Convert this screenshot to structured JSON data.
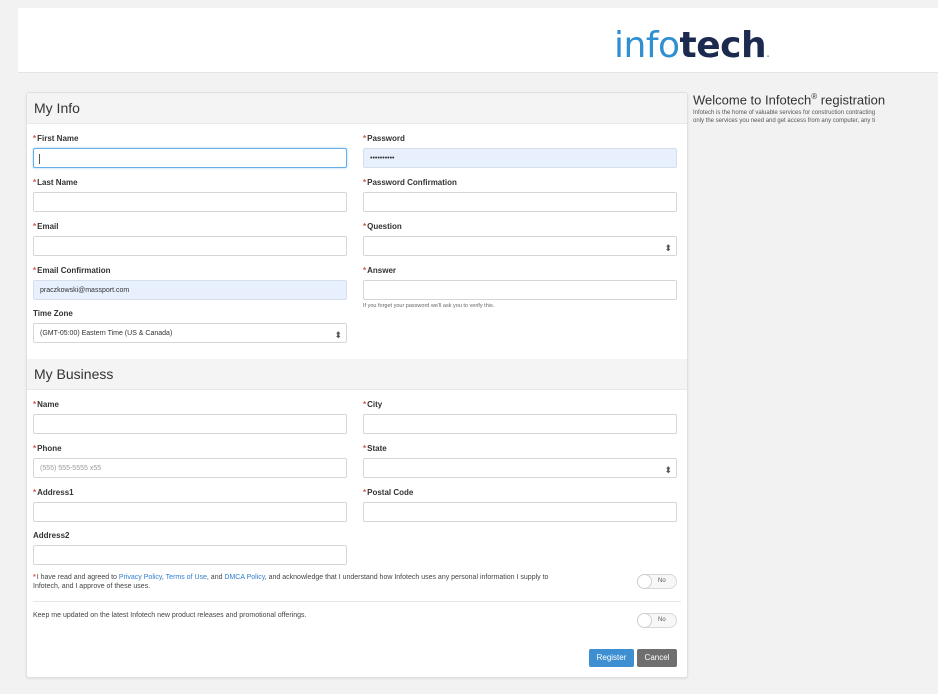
{
  "header": {
    "logo_part1": "info",
    "logo_part2": "tech",
    "logo_dot": "."
  },
  "my_info": {
    "heading": "My Info",
    "first_name": {
      "label": "First Name",
      "value": ""
    },
    "last_name": {
      "label": "Last Name",
      "value": ""
    },
    "email": {
      "label": "Email",
      "value": ""
    },
    "email_confirmation": {
      "label": "Email Confirmation",
      "value": "praczkowski@massport.com"
    },
    "time_zone": {
      "label": "Time Zone",
      "value": "(GMT-05:00) Eastern Time (US & Canada)"
    },
    "password": {
      "label": "Password",
      "value": "••••••••••"
    },
    "password_confirmation": {
      "label": "Password Confirmation",
      "value": ""
    },
    "question": {
      "label": "Question",
      "value": ""
    },
    "answer": {
      "label": "Answer",
      "value": "",
      "hint": "If you forget your password we'll ask you to verify this."
    }
  },
  "my_business": {
    "heading": "My Business",
    "name": {
      "label": "Name",
      "value": ""
    },
    "phone": {
      "label": "Phone",
      "placeholder": "(555) 555-5555 x55"
    },
    "address1": {
      "label": "Address1",
      "value": ""
    },
    "address2": {
      "label": "Address2",
      "value": ""
    },
    "city": {
      "label": "City",
      "value": ""
    },
    "state": {
      "label": "State",
      "value": ""
    },
    "postal_code": {
      "label": "Postal Code",
      "value": ""
    }
  },
  "consent": {
    "text_before": "I have read and agreed to ",
    "privacy_link": "Privacy Policy",
    "sep1": ", ",
    "terms_link": "Terms of Use",
    "sep2": ", and ",
    "dmca_link": "DMCA Policy",
    "text_after": ", and acknowledge that I understand how Infotech uses any personal information I supply to Infotech, and I approve of these uses.",
    "toggle_label": "No"
  },
  "updates": {
    "text": "Keep me updated on the latest Infotech new product releases and promotional offerings.",
    "toggle_label": "No"
  },
  "buttons": {
    "register": "Register",
    "cancel": "Cancel"
  },
  "welcome": {
    "title_before": "Welcome to Infotech",
    "title_sup": "®",
    "title_after": " registration",
    "line1": "Infotech is the home of valuable services for construction contracting",
    "line2": "only the services you need and get access from any computer, any ti"
  },
  "icons": {
    "select_arrow": "select-chevrons-icon"
  }
}
